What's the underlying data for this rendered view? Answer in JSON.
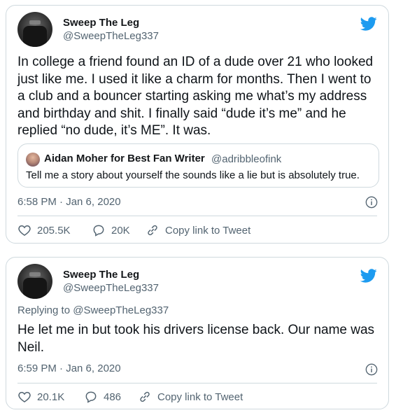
{
  "tweets": [
    {
      "author": {
        "name": "Sweep The Leg",
        "handle": "@SweepTheLeg337"
      },
      "text": "In college a friend found an ID of a dude over 21 who looked\njust like me. I used it like a charm for months. Then I went to\na club and a bouncer starting asking me what’s my address\nand birthday and shit. I finally said “dude it’s me” and he\nreplied “no dude, it’s ME”. It was.",
      "quote": {
        "name": "Aidan Moher for Best Fan Writer",
        "handle": "@adribbleofink",
        "text": "Tell me a story about yourself the sounds like a lie but is absolutely true."
      },
      "timestamp": "6:58 PM · Jan 6, 2020",
      "likes": "205.5K",
      "replies": "20K",
      "copy_link": "Copy link to Tweet"
    },
    {
      "author": {
        "name": "Sweep The Leg",
        "handle": "@SweepTheLeg337"
      },
      "replying_to": "Replying to @SweepTheLeg337",
      "text": "He let me in but took his drivers license back. Our name was\nNeil.",
      "timestamp": "6:59 PM · Jan 6, 2020",
      "likes": "20.1K",
      "replies": "486",
      "copy_link": "Copy link to Tweet"
    }
  ],
  "colors": {
    "twitter_blue": "#1d9bf0",
    "secondary_text": "#536471",
    "border": "#cfd9de"
  },
  "icons": [
    "twitter-bird-icon",
    "info-icon",
    "heart-icon",
    "reply-icon",
    "link-icon"
  ]
}
